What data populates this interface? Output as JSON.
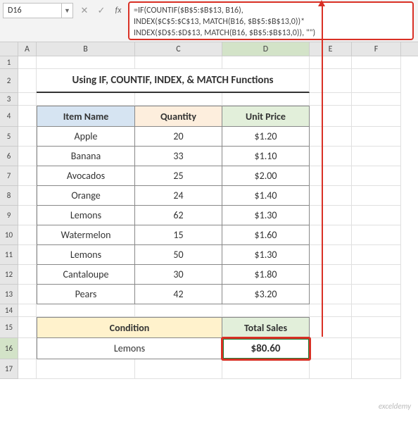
{
  "namebox": "D16",
  "formula": {
    "line1": "=IF(COUNTIF($B$5:$B$13, B16),",
    "line2": "INDEX($C$5:$C$13, MATCH(B16, $B$5:$B$13,0))*",
    "line3": "INDEX($D$5:$D$13, MATCH(B16, $B$5:$B$13,0)), \"\")"
  },
  "col_labels": {
    "A": "A",
    "B": "B",
    "C": "C",
    "D": "D",
    "E": "E",
    "F": "F"
  },
  "row_labels": [
    "1",
    "2",
    "3",
    "4",
    "5",
    "6",
    "7",
    "8",
    "9",
    "10",
    "11",
    "12",
    "13",
    "14",
    "15",
    "16",
    "17"
  ],
  "title": "Using IF, COUNTIF, INDEX, & MATCH Functions",
  "headers": {
    "item": "Item Name",
    "qty": "Quantity",
    "price": "Unit Price"
  },
  "rows": [
    {
      "item": "Apple",
      "qty": "20",
      "price": "$1.20"
    },
    {
      "item": "Banana",
      "qty": "33",
      "price": "$1.10"
    },
    {
      "item": "Avocados",
      "qty": "25",
      "price": "$2.00"
    },
    {
      "item": "Orange",
      "qty": "24",
      "price": "$1.40"
    },
    {
      "item": "Lemons",
      "qty": "62",
      "price": "$1.30"
    },
    {
      "item": "Watermelon",
      "qty": "15",
      "price": "$1.60"
    },
    {
      "item": "Lemons",
      "qty": "50",
      "price": "$1.30"
    },
    {
      "item": "Cantaloupe",
      "qty": "30",
      "price": "$1.80"
    },
    {
      "item": "Pears",
      "qty": "42",
      "price": "$3.20"
    }
  ],
  "cond": {
    "h1": "Condition",
    "h2": "Total Sales",
    "value": "Lemons",
    "total": "$80.60"
  },
  "watermark": "exceldemy",
  "colors": {
    "accent_red": "#d93025",
    "accent_green": "#1a7f37"
  }
}
